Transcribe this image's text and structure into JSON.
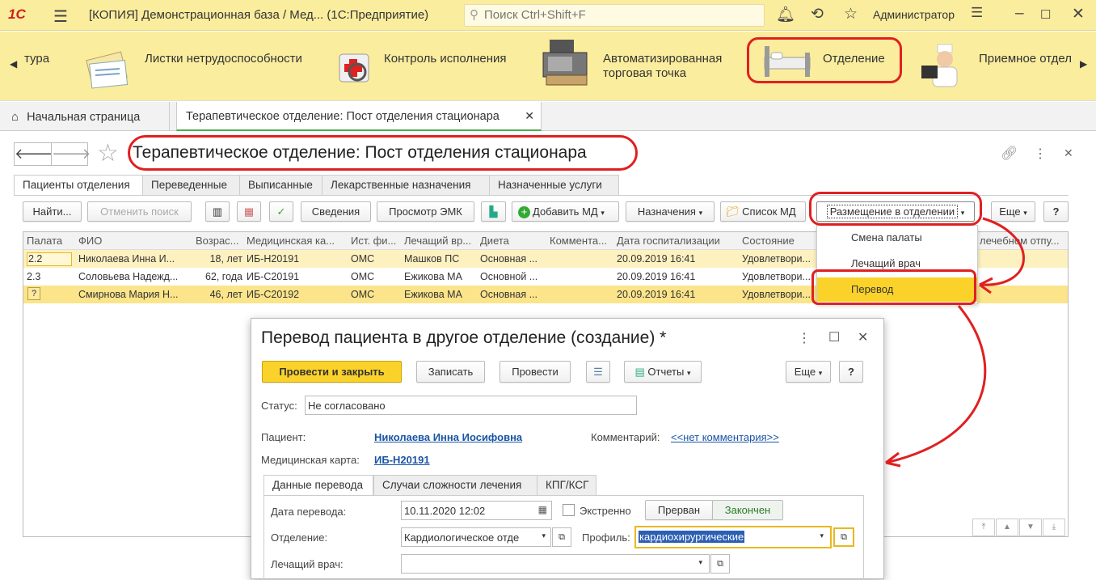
{
  "topbar": {
    "logo": "1С",
    "title": "[КОПИЯ] Демонстрационная база / Мед...  (1С:Предприятие)",
    "search_placeholder": "Поиск Ctrl+Shift+F",
    "user": "Администратор"
  },
  "sections": [
    {
      "label": "тура"
    },
    {
      "label": "Листки нетрудоспособности"
    },
    {
      "label": "Контроль исполнения"
    },
    {
      "label": "Автоматизированная торговая точка"
    },
    {
      "label": "Отделение"
    },
    {
      "label": "Приемное отдел"
    }
  ],
  "window_tabs": {
    "home": "Начальная страница",
    "active": "Терапевтическое отделение: Пост отделения стационара"
  },
  "form": {
    "title": "Терапевтическое отделение: Пост отделения стационара",
    "tabs": [
      "Пациенты отделения",
      "Переведенные",
      "Выписанные",
      "Лекарственные назначения",
      "Назначенные услуги"
    ],
    "toolbar": {
      "find": "Найти...",
      "cancel_search": "Отменить поиск",
      "info": "Сведения",
      "view_emk": "Просмотр ЭМК",
      "add_md": "Добавить МД",
      "appointments": "Назначения",
      "list_md": "Список МД",
      "placement": "Размещение в отделении",
      "more": "Еще",
      "help": "?"
    },
    "table": {
      "columns": [
        "Палата",
        "ФИО",
        "Возрас...",
        "Медицинская ка...",
        "Ист. фи...",
        "Лечащий вр...",
        "Диета",
        "Коммента...",
        "Дата госпитализации",
        "Состояние",
        "лечебном отпу..."
      ],
      "rows": [
        {
          "ward": "2.2",
          "name": "Николаева Инна И...",
          "age": "18,  лет",
          "card": "ИБ-Н20191",
          "fin": "ОМС",
          "doctor": "Машков ПС",
          "diet": "Основная ...",
          "comment": "",
          "date": "20.09.2019 16:41",
          "state": "Удовлетвори..."
        },
        {
          "ward": "2.3",
          "name": "Соловьева Надежд...",
          "age": "62, года",
          "card": "ИБ-С20191",
          "fin": "ОМС",
          "doctor": "Ежикова МА",
          "diet": "Основной ...",
          "comment": "",
          "date": "20.09.2019 16:41",
          "state": "Удовлетвори..."
        },
        {
          "ward": "",
          "name": "Смирнова Мария Н...",
          "age": "46,  лет",
          "card": "ИБ-С20192",
          "fin": "ОМС",
          "doctor": "Ежикова МА",
          "diet": "Основная ...",
          "comment": "",
          "date": "20.09.2019 16:41",
          "state": "Удовлетвори..."
        }
      ]
    }
  },
  "dropdown": {
    "items": [
      "Смена палаты",
      "Лечащий врач",
      "Перевод"
    ],
    "selected": "Перевод"
  },
  "dialog": {
    "title": "Перевод пациента в другое отделение (создание) *",
    "buttons": {
      "post_close": "Провести и закрыть",
      "save": "Записать",
      "post": "Провести",
      "reports": "Отчеты",
      "more": "Еще",
      "help": "?"
    },
    "status_label": "Статус:",
    "status_value": "Не согласовано",
    "patient_label": "Пациент:",
    "patient_value": "Николаева Инна Иосифовна",
    "comment_label": "Комментарий:",
    "comment_value": "<<нет комментария>>",
    "card_label": "Медицинская карта:",
    "card_value": "ИБ-Н20191",
    "tabs": [
      "Данные перевода",
      "Случаи сложности лечения",
      "КПГ/КСГ"
    ],
    "date_label": "Дата перевода:",
    "date_value": "10.11.2020 12:02",
    "urgent_label": "Экстренно",
    "interrupted": "Прерван",
    "finished": "Закончен",
    "dept_label": "Отделение:",
    "dept_value": "Кардиологическое отде",
    "profile_label": "Профиль:",
    "profile_value": "кардиохирургические",
    "doctor_label": "Лечащий врач:",
    "doctor_value": ""
  },
  "colors": {
    "topbar": "#fbed9e",
    "accent": "#fbd22a",
    "annotation": "#e02020",
    "link": "#1a55a5"
  }
}
